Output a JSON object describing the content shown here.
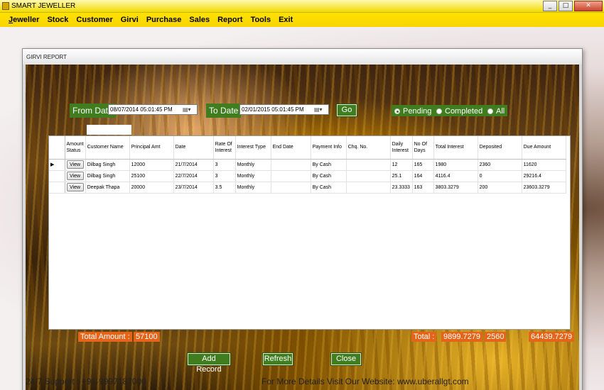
{
  "app": {
    "title": "SMART JEWELLER",
    "window_buttons": [
      "_",
      "□",
      "✕"
    ]
  },
  "menu": [
    {
      "label": "Jeweller",
      "access": "J",
      "rest": "eweller"
    },
    {
      "label": "Stock"
    },
    {
      "label": "Customer"
    },
    {
      "label": "Girvi"
    },
    {
      "label": "Purchase"
    },
    {
      "label": "Sales"
    },
    {
      "label": "Report"
    },
    {
      "label": "Tools"
    },
    {
      "label": "Exit"
    }
  ],
  "dialog": {
    "title": "GIRVI REPORT",
    "from_label": "From Date",
    "from_value": "08/07/2014 05:01:45 PM",
    "to_label": "To Date",
    "to_value": "02/01/2015 05:01:45 PM",
    "go_label": "Go",
    "radios": {
      "pending": "Pending",
      "completed": "Completed",
      "all": "All",
      "selected": "pending"
    }
  },
  "grid": {
    "columns": [
      "Amount Status",
      "Customer Name",
      "Principal Amt",
      "Date",
      "Rate Of Interest",
      "Interest Type",
      "End Date",
      "Payment Info",
      "Chq. No.",
      "Daily Interest",
      "No Of Days",
      "Total Interest",
      "Deposited",
      "Due Amount"
    ],
    "view_label": "View",
    "rows": [
      {
        "customer": "Dilbag Singh",
        "principal": "12000",
        "date": "21/7/2014",
        "rate": "3",
        "type": "Monthly",
        "end": "",
        "payment": "By Cash",
        "chq": "",
        "daily": "12",
        "days": "165",
        "total_interest": "1980",
        "deposited": "2360",
        "due": "11620"
      },
      {
        "customer": "Dilbag Singh",
        "principal": "25100",
        "date": "22/7/2014",
        "rate": "3",
        "type": "Monthly",
        "end": "",
        "payment": "By Cash",
        "chq": "",
        "daily": "25.1",
        "days": "164",
        "total_interest": "4116.4",
        "deposited": "0",
        "due": "29216.4"
      },
      {
        "customer": "Deepak Thapa",
        "principal": "20000",
        "date": "23/7/2014",
        "rate": "3.5",
        "type": "Monthly",
        "end": "",
        "payment": "By Cash",
        "chq": "",
        "daily": "23.3333",
        "days": "163",
        "total_interest": "3803.3279",
        "deposited": "200",
        "due": "23603.3279"
      }
    ]
  },
  "summary": {
    "total_amount_label": "Total Amount :",
    "total_amount": "57100",
    "total_label": "Total :",
    "total_interest": "9899.7279",
    "total_deposited": "2560",
    "total_due": "64439.7279"
  },
  "buttons": {
    "add": "Add Record",
    "refresh": "Refresh",
    "close": "Close"
  },
  "footer": {
    "support": "24/7 Support : +91-9997187000",
    "website": "For More Details Visit Our Website: www.uberallgt.com"
  }
}
